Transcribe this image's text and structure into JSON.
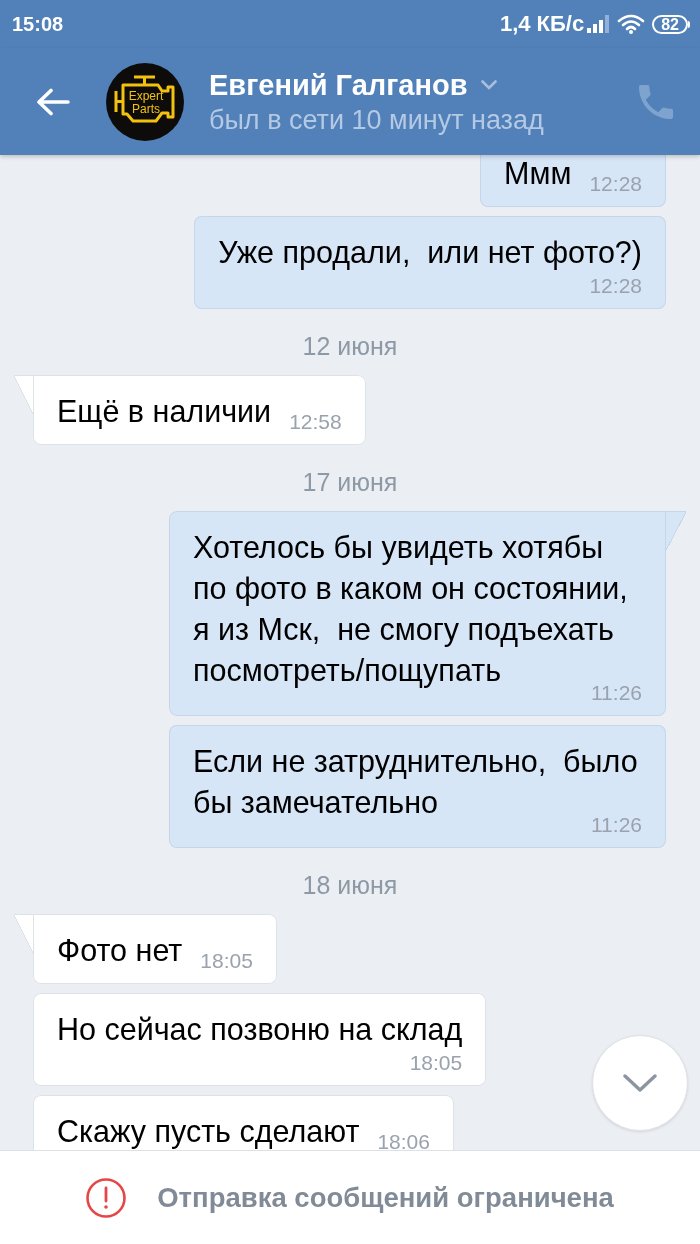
{
  "status_bar": {
    "time": "15:08",
    "network_speed": "1,4 КБ/с",
    "battery": "82"
  },
  "header": {
    "avatar_logo": [
      "Expert",
      "Parts"
    ],
    "name": "Евгений Галганов",
    "presence": "был в сети 10 минут назад",
    "call_disabled": true
  },
  "messages": [
    {
      "kind": "outgoing",
      "text": "Ммм",
      "time": "12:28",
      "tail": false
    },
    {
      "kind": "outgoing",
      "text": "Уже продали,  или нет фото?)",
      "time": "12:28",
      "tail": false
    },
    {
      "kind": "date",
      "text": "12 июня"
    },
    {
      "kind": "incoming",
      "text": "Ещё в наличии",
      "time": "12:58",
      "tail": true
    },
    {
      "kind": "date",
      "text": "17 июня"
    },
    {
      "kind": "outgoing",
      "text": "Хотелось бы увидеть хотябы по фото в каком он состоянии, я из Мск,  не смогу подъехать посмотреть/пощупать",
      "time": "11:26",
      "tail": true
    },
    {
      "kind": "outgoing",
      "text": "Если не затруднительно,  было бы замечательно",
      "time": "11:26",
      "tail": false
    },
    {
      "kind": "date",
      "text": "18 июня"
    },
    {
      "kind": "incoming",
      "text": "Фото нет",
      "time": "18:05",
      "tail": true
    },
    {
      "kind": "incoming",
      "text": "Но сейчас позвоню на склад",
      "time": "18:05",
      "tail": false
    },
    {
      "kind": "incoming",
      "text": "Скажу пусть сделают",
      "time": "18:06",
      "tail": false
    }
  ],
  "notice": {
    "text": "Отправка сообщений ограничена"
  }
}
